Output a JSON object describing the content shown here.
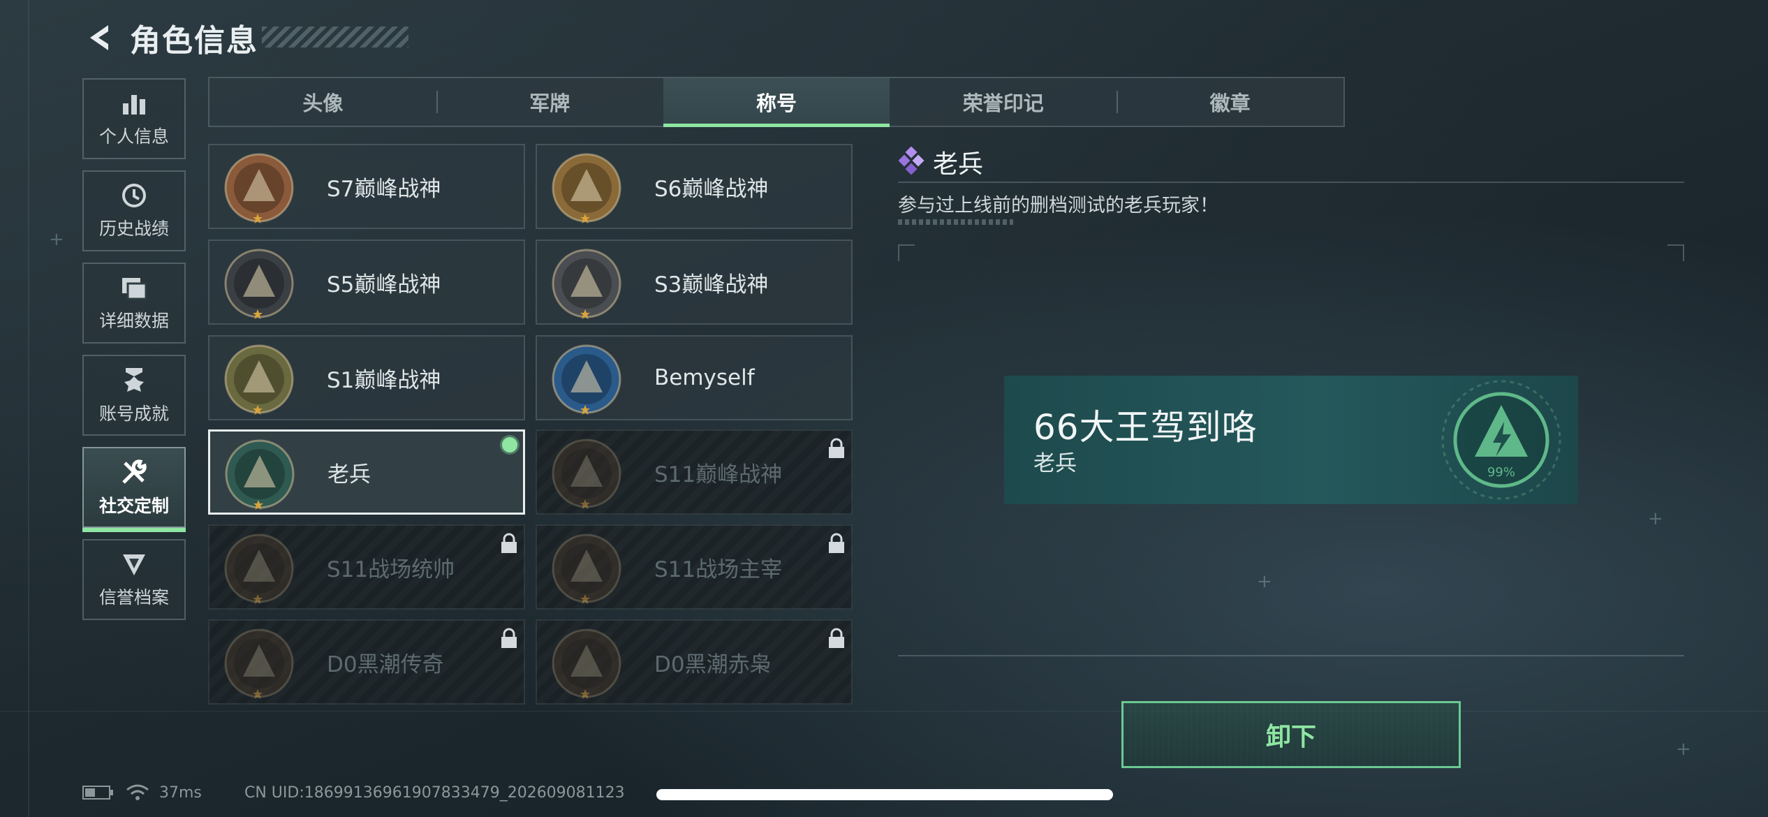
{
  "header": {
    "title": "角色信息"
  },
  "sidebar": {
    "items": [
      {
        "label": "个人信息",
        "icon": "bar-chart-icon",
        "active": false
      },
      {
        "label": "历史战绩",
        "icon": "clock-icon",
        "active": false
      },
      {
        "label": "详细数据",
        "icon": "folder-icon",
        "active": false
      },
      {
        "label": "账号成就",
        "icon": "achievement-icon",
        "active": false
      },
      {
        "label": "社交定制",
        "icon": "wrench-icon",
        "active": true
      },
      {
        "label": "信誉档案",
        "icon": "shield-icon",
        "active": false
      }
    ]
  },
  "tabs": [
    {
      "label": "头像"
    },
    {
      "label": "军牌"
    },
    {
      "label": "称号"
    },
    {
      "label": "荣誉印记"
    },
    {
      "label": "徽章"
    }
  ],
  "titles": [
    {
      "name": "S7巅峰战神",
      "locked": false,
      "medal_color": "#8a5a3a"
    },
    {
      "name": "S6巅峰战神",
      "locked": false,
      "medal_color": "#8a6a38"
    },
    {
      "name": "S5巅峰战神",
      "locked": false,
      "medal_color": "#3a3f44"
    },
    {
      "name": "S3巅峰战神",
      "locked": false,
      "medal_color": "#4a4e52"
    },
    {
      "name": "S1巅峰战神",
      "locked": false,
      "medal_color": "#6a6a40"
    },
    {
      "name": "Bemyself",
      "locked": false,
      "medal_color": "#2a5a8a"
    },
    {
      "name": "老兵",
      "locked": false,
      "selected": true,
      "medal_color": "#2f5a52"
    },
    {
      "name": "S11巅峰战神",
      "locked": true,
      "medal_color": "#4a3a2c"
    },
    {
      "name": "S11战场统帅",
      "locked": true,
      "medal_color": "#4a3a2c"
    },
    {
      "name": "S11战场主宰",
      "locked": true,
      "medal_color": "#4a3a2c"
    },
    {
      "name": "D0黑潮传奇",
      "locked": true,
      "medal_color": "#4a3a2c"
    },
    {
      "name": "D0黑潮赤枭",
      "locked": true,
      "medal_color": "#4a3a2c"
    }
  ],
  "detail": {
    "title": "老兵",
    "description": "参与过上线前的删档测试的老兵玩家！"
  },
  "preview": {
    "player_name": "66大王驾到咯",
    "title": "老兵",
    "emblem_text": "99%"
  },
  "actions": {
    "unequip_label": "卸下"
  },
  "status": {
    "ping": "37ms",
    "uid": "CN UID:186991369619078334​79_202609081123"
  },
  "colors": {
    "accent": "#8ee6a2",
    "banner": "#24585b"
  }
}
